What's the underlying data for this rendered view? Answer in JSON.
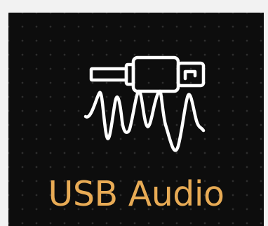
{
  "tile": {
    "label": "USB Audio",
    "icon": "usb-audio-waveform-icon",
    "background": "#0d0d0d",
    "label_color": "#e8ab55",
    "icon_color": "#ffffff"
  }
}
